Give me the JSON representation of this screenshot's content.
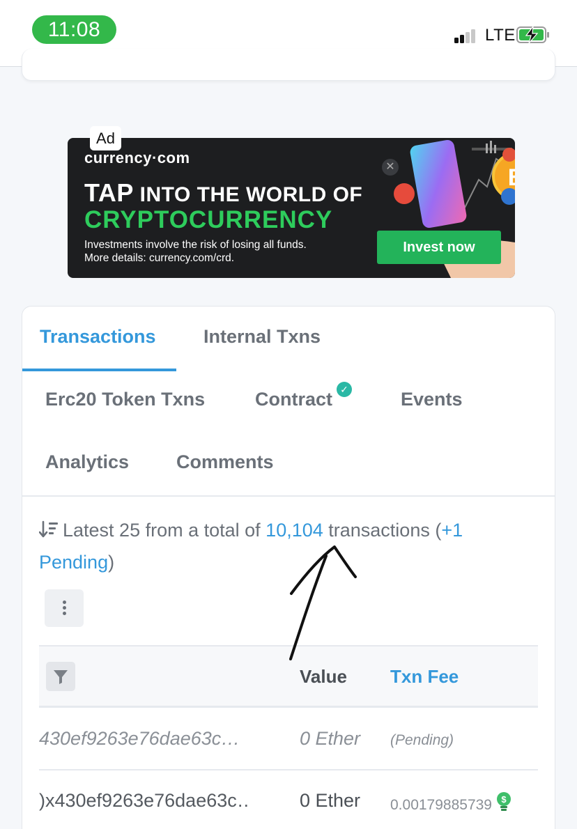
{
  "status_bar": {
    "time": "11:08",
    "network": "LTE",
    "signal_bars": 2,
    "battery_charging": true,
    "colors": {
      "time_pill": "#33b84a",
      "battery": "#33b84a"
    }
  },
  "ad": {
    "tag": "Ad",
    "brand": "currency·com",
    "headline_tap": "TAP",
    "headline_rest": " INTO THE WORLD OF",
    "headline_accent": "CRYPTOCURRENCY",
    "disclaimer_line1": "Investments involve the risk of losing all funds.",
    "disclaimer_line2": "More details: currency.com/crd.",
    "cta": "Invest now",
    "colors": {
      "accent": "#2ecc5c",
      "cta": "#23b35a",
      "background": "#1d1e20"
    }
  },
  "tabs": [
    {
      "label": "Transactions",
      "active": true
    },
    {
      "label": "Internal Txns",
      "active": false
    },
    {
      "label": "Erc20 Token Txns",
      "active": false
    },
    {
      "label": "Contract",
      "active": false,
      "verified_icon": "check-circle-icon"
    },
    {
      "label": "Events",
      "active": false
    },
    {
      "label": "Analytics",
      "active": false
    },
    {
      "label": "Comments",
      "active": false
    }
  ],
  "summary": {
    "prefix": "Latest 25 from a total of ",
    "total": "10,104",
    "middle": " transactions (",
    "pending_count": "+1",
    "pending_word": "Pending",
    "suffix": ")"
  },
  "table": {
    "headers": {
      "value": "Value",
      "txn_fee": "Txn Fee"
    },
    "rows": [
      {
        "hash": "430ef9263e76dae63c…",
        "value": "0 Ether",
        "fee": "(Pending)",
        "pending": true
      },
      {
        "hash": ")x430ef9263e76dae63c…",
        "value": "0 Ether",
        "fee": "0.00179885739",
        "pending": false
      }
    ]
  },
  "colors": {
    "link": "#3498db",
    "verified": "#2ab8a5"
  }
}
